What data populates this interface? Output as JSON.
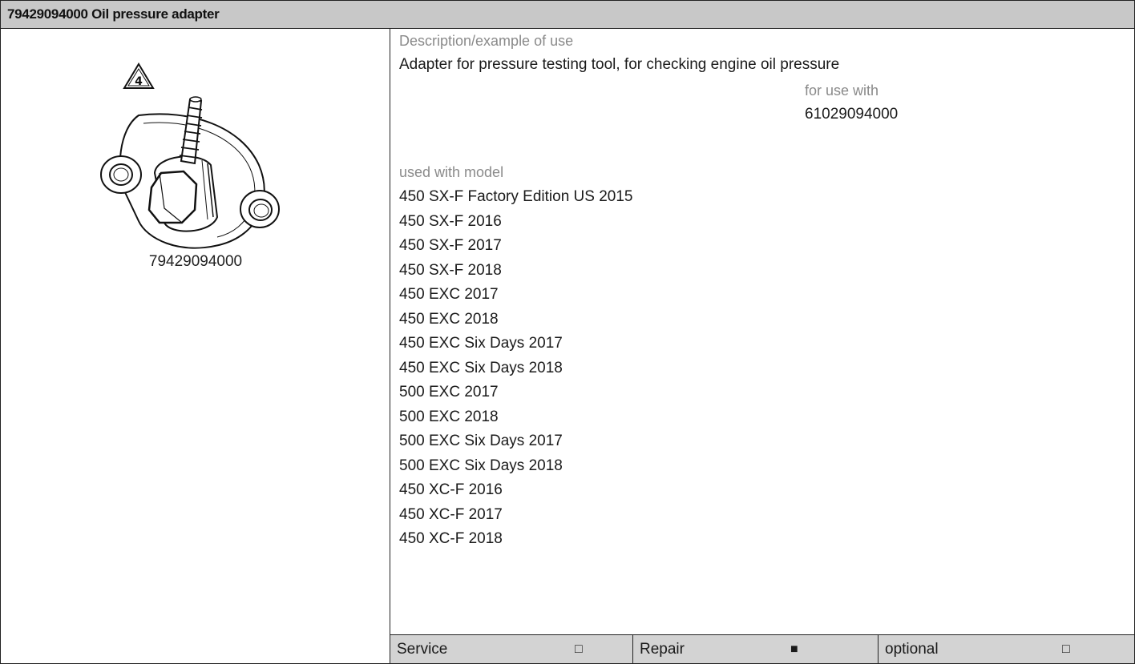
{
  "header": {
    "title": "79429094000 Oil pressure adapter"
  },
  "figure": {
    "warning_number": "4",
    "part_number": "79429094000"
  },
  "details": {
    "description_label": "Description/example of use",
    "description": "Adapter for pressure testing tool, for checking engine oil pressure",
    "for_use_with_label": "for use with",
    "for_use_with_value": "61029094000",
    "used_with_model_label": "used with model",
    "models": [
      "450 SX-F Factory Edition US 2015",
      "450 SX-F 2016",
      "450 SX-F 2017",
      "450 SX-F 2018",
      "450 EXC 2017",
      "450 EXC 2018",
      "450 EXC Six Days 2017",
      "450 EXC Six Days 2018",
      "500 EXC 2017",
      "500 EXC 2018",
      "500 EXC Six Days 2017",
      "500 EXC Six Days 2018",
      "450 XC-F 2016",
      "450 XC-F 2017",
      "450 XC-F 2018"
    ]
  },
  "footer": {
    "service": {
      "label": "Service",
      "box": "□"
    },
    "repair": {
      "label": "Repair",
      "box": "■"
    },
    "optional": {
      "label": "optional",
      "box": "□"
    }
  }
}
